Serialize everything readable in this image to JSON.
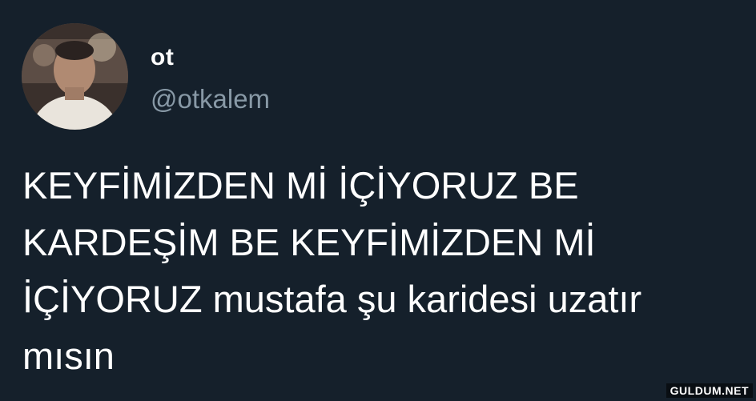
{
  "tweet": {
    "avatar_icon": "profile-photo",
    "display_name": "ot",
    "handle": "@otkalem",
    "text": "KEYFİMİZDEN Mİ İÇİYORUZ BE\nKARDEŞİM BE KEYFİMİZDEN Mİ\nİÇİYORUZ mustafa şu karidesi uzatır\nmısın"
  },
  "watermark": {
    "text": "GULDUM.NET"
  },
  "colors": {
    "background": "#15202b",
    "name": "#ffffff",
    "handle": "#8899a6",
    "text": "#ffffff"
  }
}
